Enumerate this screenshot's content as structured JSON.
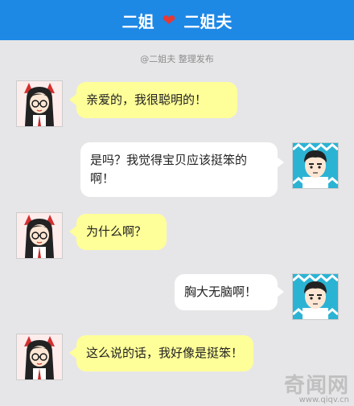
{
  "header": {
    "left_name": "二姐",
    "heart_icon": "heart-icon",
    "right_name": "二姐夫",
    "accent": "#1e88e5",
    "heart_color": "#e53935"
  },
  "credit": "@二姐夫 整理发布",
  "messages": [
    {
      "sender": "二姐",
      "side": "left",
      "text": "亲爱的，我很聪明的！"
    },
    {
      "sender": "二姐夫",
      "side": "right",
      "text": "是吗？我觉得宝贝应该挺笨的啊！"
    },
    {
      "sender": "二姐",
      "side": "left",
      "text": "为什么啊？"
    },
    {
      "sender": "二姐夫",
      "side": "right",
      "text": "胸大无脑啊！"
    },
    {
      "sender": "二姐",
      "side": "left",
      "text": "这么说的话，我好像是挺笨！"
    }
  ],
  "colors": {
    "left_bubble": "#ffff99",
    "right_bubble": "#ffffff",
    "background": "#e6e6e8"
  },
  "watermark": {
    "logo": "奇闻网",
    "url": "www.qiqv.cn"
  }
}
